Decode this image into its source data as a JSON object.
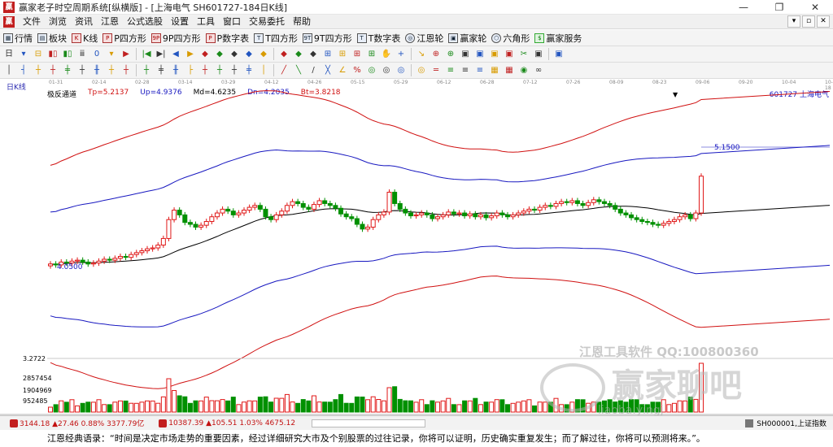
{
  "window": {
    "logo_text": "贏",
    "title": "赢家老子时空周期系统[纵横版] - [上海电气  SH601727-184日K线]",
    "minimize": "—",
    "maximize": "❐",
    "close": "✕"
  },
  "menu": {
    "items": [
      "文件",
      "浏览",
      "资讯",
      "江恩",
      "公式选股",
      "设置",
      "工具",
      "窗口",
      "交易委托",
      "帮助"
    ],
    "right_buttons": [
      "▾",
      "▫",
      "✕"
    ]
  },
  "toolbar1": {
    "buttons": [
      {
        "icon": "grid",
        "label": "行情"
      },
      {
        "icon": "blocks",
        "label": "板块"
      },
      {
        "icon": "kline",
        "label": "K线"
      },
      {
        "icon": "p",
        "label": "P四方形"
      },
      {
        "icon": "9p",
        "label": "9P四方形"
      },
      {
        "icon": "p",
        "label": "P数字表"
      },
      {
        "icon": "t",
        "label": "T四方形"
      },
      {
        "icon": "9t",
        "label": "9T四方形"
      },
      {
        "icon": "t",
        "label": "T数字表"
      },
      {
        "icon": "wheel",
        "label": "江恩轮"
      },
      {
        "icon": "winner",
        "label": "赢家轮"
      },
      {
        "icon": "hex",
        "label": "六角形"
      },
      {
        "icon": "dollar",
        "label": "赢家服务"
      }
    ]
  },
  "toolbar2": {
    "items": [
      "日",
      "▾",
      "⊟",
      "▮▯",
      "▮▯",
      "ⅲ",
      "0",
      "▾",
      "▶",
      "|◀",
      "▶|",
      "◀",
      "▶",
      "◆",
      "◆",
      "◆",
      "◆",
      "◆",
      "◆",
      "◆",
      "◆",
      "⊞",
      "⊞",
      "⊞",
      "⊞",
      "✋",
      "+",
      "↘",
      "⊕",
      "⊕",
      "▣",
      "▣",
      "▣",
      "▣",
      "✂",
      "▣",
      "▣"
    ]
  },
  "toolbar3": {
    "items": [
      "│",
      "┤",
      "┼",
      "┼",
      "╪",
      "┼",
      "╫",
      "┼",
      "┼",
      "┼",
      "╪",
      "╫",
      "├",
      "┼",
      "┼",
      "┼",
      "╪",
      "│",
      "╱",
      "╲",
      "/",
      "╳",
      "∠",
      "%",
      "◎",
      "◎",
      "◎",
      "◎",
      "═",
      "≡",
      "≡",
      "≡",
      "▦",
      "▦",
      "◉",
      "∞"
    ]
  },
  "chart": {
    "period_label": "日K线",
    "date_ticks": [
      "01-31",
      "02-14",
      "02-28",
      "03-14",
      "03-29",
      "04-12",
      "04-26",
      "05-15",
      "05-29",
      "06-12",
      "06-28",
      "07-12",
      "07-26",
      "08-09",
      "08-23",
      "09-06",
      "09-20",
      "10-04",
      "10-18"
    ],
    "indicator": {
      "name": "极反通道",
      "tp": "Tp=5.2137",
      "up": "Up=4.9376",
      "md": "Md=4.6235",
      "dn": "Dn=4.2035",
      "bt": "Bt=3.8218"
    },
    "stock_id": "601727  上海电气",
    "dropdown_mark": "▼",
    "high_label": "5.1500",
    "low_label": "4.0500",
    "vol_labels": [
      "3.2722",
      "2857454",
      "1904969",
      "952485"
    ],
    "watermark_line1": "江恩工具软件  QQ:100800360",
    "watermark_line2": "赢家聊吧",
    "watermark_line3": "liaoba.yingj"
  },
  "chart_data": {
    "type": "candlestick",
    "title": "极反通道",
    "xlabel": "",
    "ylabel": "",
    "x_ticks": [
      "01-31",
      "02-14",
      "02-28",
      "03-14",
      "03-29",
      "04-12",
      "04-26",
      "05-15",
      "05-29",
      "06-12",
      "06-28",
      "07-12",
      "07-26",
      "08-09",
      "08-23",
      "09-06",
      "09-20",
      "10-04",
      "10-18"
    ],
    "price_ylim": [
      3.2,
      5.8
    ],
    "close": [
      4.08,
      4.07,
      4.1,
      4.09,
      4.11,
      4.12,
      4.1,
      4.08,
      4.09,
      4.11,
      4.13,
      4.12,
      4.14,
      4.16,
      4.15,
      4.18,
      4.2,
      4.22,
      4.24,
      4.25,
      4.28,
      4.35,
      4.55,
      4.65,
      4.6,
      4.52,
      4.5,
      4.47,
      4.49,
      4.53,
      4.58,
      4.62,
      4.66,
      4.64,
      4.6,
      4.62,
      4.65,
      4.68,
      4.7,
      4.66,
      4.58,
      4.55,
      4.6,
      4.64,
      4.7,
      4.74,
      4.72,
      4.68,
      4.66,
      4.71,
      4.75,
      4.72,
      4.7,
      4.67,
      4.61,
      4.58,
      4.56,
      4.5,
      4.45,
      4.47,
      4.55,
      4.6,
      4.63,
      4.84,
      4.72,
      4.66,
      4.62,
      4.59,
      4.6,
      4.62,
      4.6,
      4.56,
      4.58,
      4.6,
      4.63,
      4.61,
      4.62,
      4.59,
      4.61,
      4.58,
      4.6,
      4.57,
      4.59,
      4.62,
      4.6,
      4.58,
      4.6,
      4.62,
      4.64,
      4.66,
      4.65,
      4.68,
      4.7,
      4.69,
      4.72,
      4.74,
      4.73,
      4.75,
      4.72,
      4.7,
      4.73,
      4.76,
      4.74,
      4.72,
      4.7,
      4.66,
      4.62,
      4.6,
      4.57,
      4.55,
      4.53,
      4.52,
      4.5,
      4.49,
      4.51,
      4.53,
      4.55,
      4.58,
      4.6,
      4.56,
      4.62,
      5.01
    ],
    "middle_band_start": 4.04,
    "middle_band_end": 4.8,
    "bands": [
      "Tp",
      "Up",
      "Md",
      "Dn",
      "Bt"
    ],
    "volume_axis": [
      "2857454",
      "1904969",
      "952485"
    ]
  },
  "status": {
    "sh_index": "3144.18 ▲27.46 0.88% 3377.79亿",
    "sz_index": "10387.39 ▲105.51 1.03% 4675.12",
    "right_text": "SH000001,上证指数"
  },
  "quote": {
    "text": "江恩经典语录：“时间是决定市场走势的重要因素，经过详细研究大市及个别股票的过往记录，你将可以证明，历史确实重复发生；而了解过往，你将可以预测将来。”。"
  }
}
